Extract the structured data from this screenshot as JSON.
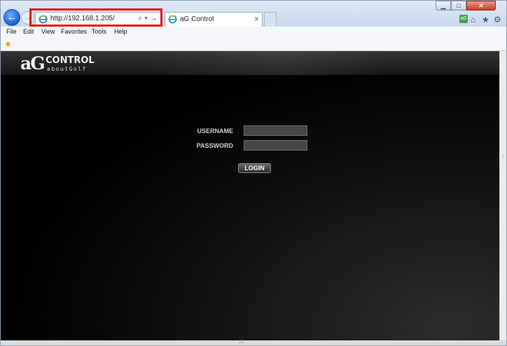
{
  "browser": {
    "address_url": "http://192.168.1.205/",
    "tab_title": "aG Control",
    "tab_close": "×",
    "back": "←",
    "forward": "→",
    "address_tools": "⌕ ▾ →",
    "window_min": "▁",
    "window_max": "□",
    "window_close": "✕",
    "ag_icon_text": "aG",
    "home_icon": "⌂",
    "star_icon": "★",
    "gear_icon": "⚙",
    "fav_star": "★"
  },
  "menu": {
    "items": [
      "File",
      "Edit",
      "View",
      "Favorites",
      "Tools",
      "Help"
    ]
  },
  "app": {
    "logo_ag": "aG",
    "logo_control": "CONTROL",
    "logo_sub": "aboutGolf",
    "username_label": "USERNAME",
    "password_label": "PASSWORD",
    "username_value": "",
    "password_value": "",
    "login_label": "LOGIN"
  },
  "scroll": {
    "grip": "⋮",
    "hgrip": "⁞⁞⁞"
  },
  "colors": {
    "highlight": "#e0141e",
    "background": "#000000"
  }
}
